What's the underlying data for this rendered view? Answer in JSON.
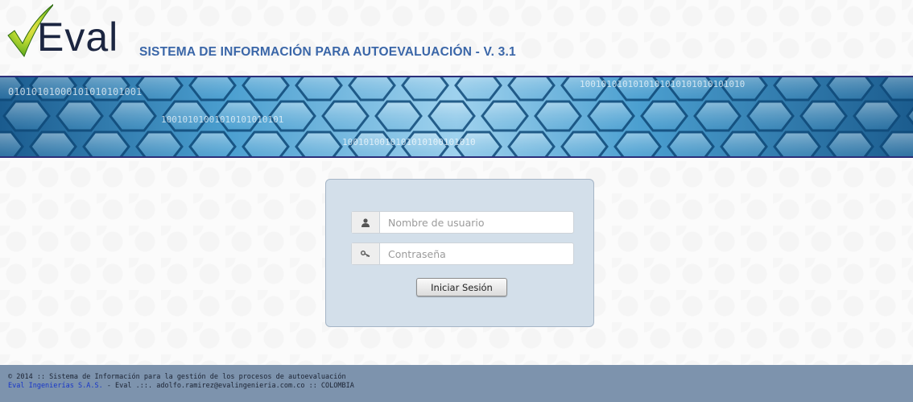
{
  "header": {
    "logo_text": "Eval",
    "subtitle": "SISTEMA DE INFORMACIÓN PARA AUTOEVALUACIÓN - V. 3.1"
  },
  "banner": {
    "binary_strings": [
      "01010101000101010101001",
      "10010101001010101010101",
      "1001010010101010100101010",
      "1001010101010101010101010101010"
    ]
  },
  "login": {
    "username_placeholder": "Nombre de usuario",
    "password_placeholder": "Contraseña",
    "submit_label": "Iniciar Sesión",
    "icons": {
      "username": "user-icon",
      "password": "key-icon"
    }
  },
  "footer": {
    "line1": "© 2014 :: Sistema de Información para la gestión de los procesos de autoevaluación",
    "company_link": "Eval Ingenierías S.A.S.",
    "line2_rest": " - Eval .::. adolfo.ramirez@evalingenieria.com.co :: COLOMBIA"
  },
  "colors": {
    "subtitle": "#3a66a8",
    "banner_border": "#2c2f7a",
    "login_box": "#d3dfea",
    "footer_bg": "#7d93ad",
    "footer_link": "#1736c9",
    "check_green": "#6ec51e",
    "check_yellow": "#f0c419"
  }
}
